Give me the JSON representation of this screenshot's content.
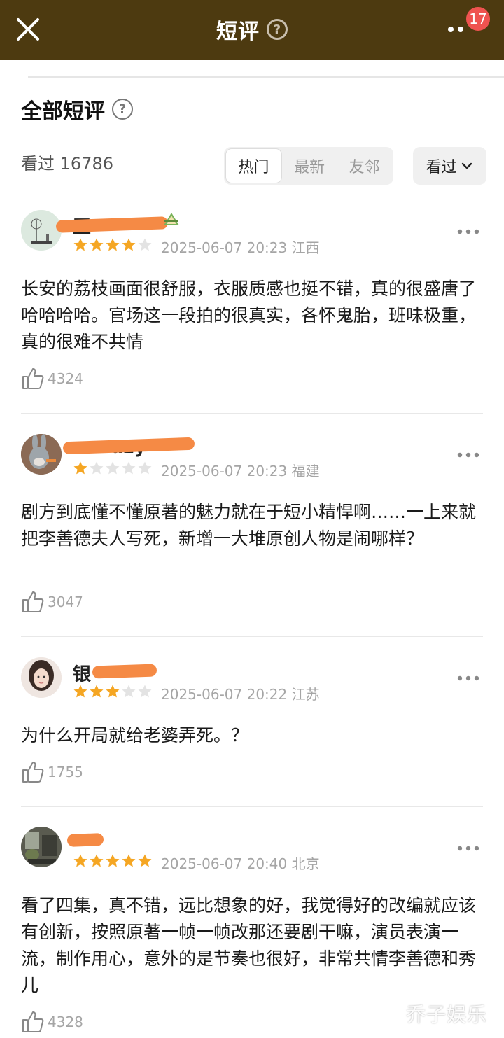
{
  "header": {
    "title": "短评",
    "help_glyph": "?",
    "notification_count": "17",
    "close_icon": "close-icon",
    "more_icon": "more-dots-icon",
    "bg_color": "#4d3a10",
    "badge_color": "#ef5350"
  },
  "section": {
    "title": "全部短评",
    "help_glyph": "?",
    "watched_label": "看过",
    "watched_count": "16786",
    "tabs": [
      {
        "label": "热门",
        "active": true
      },
      {
        "label": "最新",
        "active": false
      },
      {
        "label": "友邻",
        "active": false
      }
    ],
    "filter_label": "看过"
  },
  "reviews": [
    {
      "username": "王",
      "rating": 4,
      "datetime": "2025-06-07 20:23",
      "region": "江西",
      "content": "长安的荔枝画面很舒服，衣服质感也挺不错，真的很盛唐了哈哈哈哈。官场这一段拍的很真实，各怀鬼胎，班味极重，真的很难不共情",
      "likes": "4324"
    },
    {
      "username": "a        crazy",
      "rating": 1,
      "datetime": "2025-06-07 20:23",
      "region": "福建",
      "content": "剧方到底懂不懂原著的魅力就在于短小精悍啊……一上来就把李善德夫人写死，新增一大堆原创人物是闹哪样？",
      "likes": "3047"
    },
    {
      "username": "银",
      "rating": 3,
      "datetime": "2025-06-07 20:22",
      "region": "江苏",
      "content": "为什么开局就给老婆弄死。？",
      "likes": "1755"
    },
    {
      "username": "",
      "rating": 5,
      "datetime": "2025-06-07 20:40",
      "region": "北京",
      "content": "看了四集，真不错，远比想象的好，我觉得好的改编就应该有创新，按照原著一帧一帧改那还要剧干嘛，演员表演一流，制作用心，意外的是节奏也很好，非常共情李善德和秀儿",
      "likes": "4328"
    }
  ],
  "watermark": "乔子娱乐",
  "star_color": "#f5a623",
  "star_empty_color": "#e3e3e3"
}
